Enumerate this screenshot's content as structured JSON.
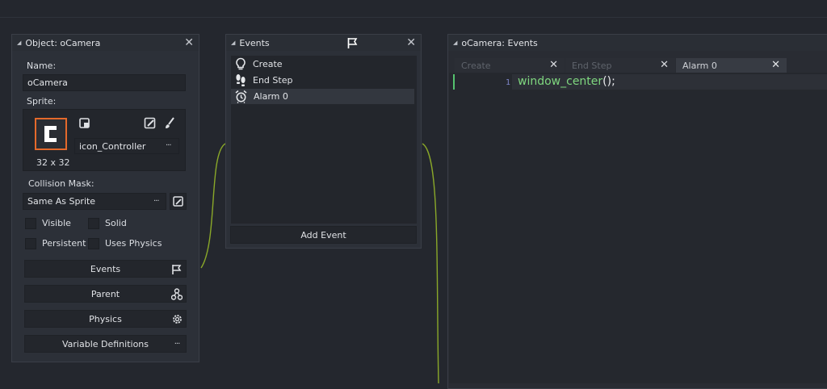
{
  "object_panel": {
    "title": "Object: oCamera",
    "name_label": "Name:",
    "name_value": "oCamera",
    "sprite_label": "Sprite:",
    "sprite_name": "icon_Controller",
    "sprite_size": "32 x 32",
    "collision_label": "Collision Mask:",
    "collision_value": "Same As Sprite",
    "checkboxes": {
      "visible": "Visible",
      "solid": "Solid",
      "persistent": "Persistent",
      "uses_physics": "Uses Physics"
    },
    "buttons": {
      "events": "Events",
      "parent": "Parent",
      "physics": "Physics",
      "variable_definitions": "Variable Definitions"
    },
    "ellipsis": "···"
  },
  "events_panel": {
    "title": "Events",
    "events": [
      {
        "label": "Create",
        "icon": "lightbulb-icon"
      },
      {
        "label": "End Step",
        "icon": "footsteps-icon"
      },
      {
        "label": "Alarm 0",
        "icon": "alarm-clock-icon"
      }
    ],
    "add_event": "Add Event"
  },
  "code_panel": {
    "title": "oCamera: Events",
    "tabs": [
      {
        "label": "Create",
        "active": false
      },
      {
        "label": "End Step",
        "active": false
      },
      {
        "label": "Alarm 0",
        "active": true
      }
    ],
    "line_number": "1",
    "code_fn": "window_center",
    "code_rest": "();"
  },
  "colors": {
    "accent_orange": "#e4692b",
    "code_green": "#7fd77f",
    "connector": "#8aa829"
  }
}
